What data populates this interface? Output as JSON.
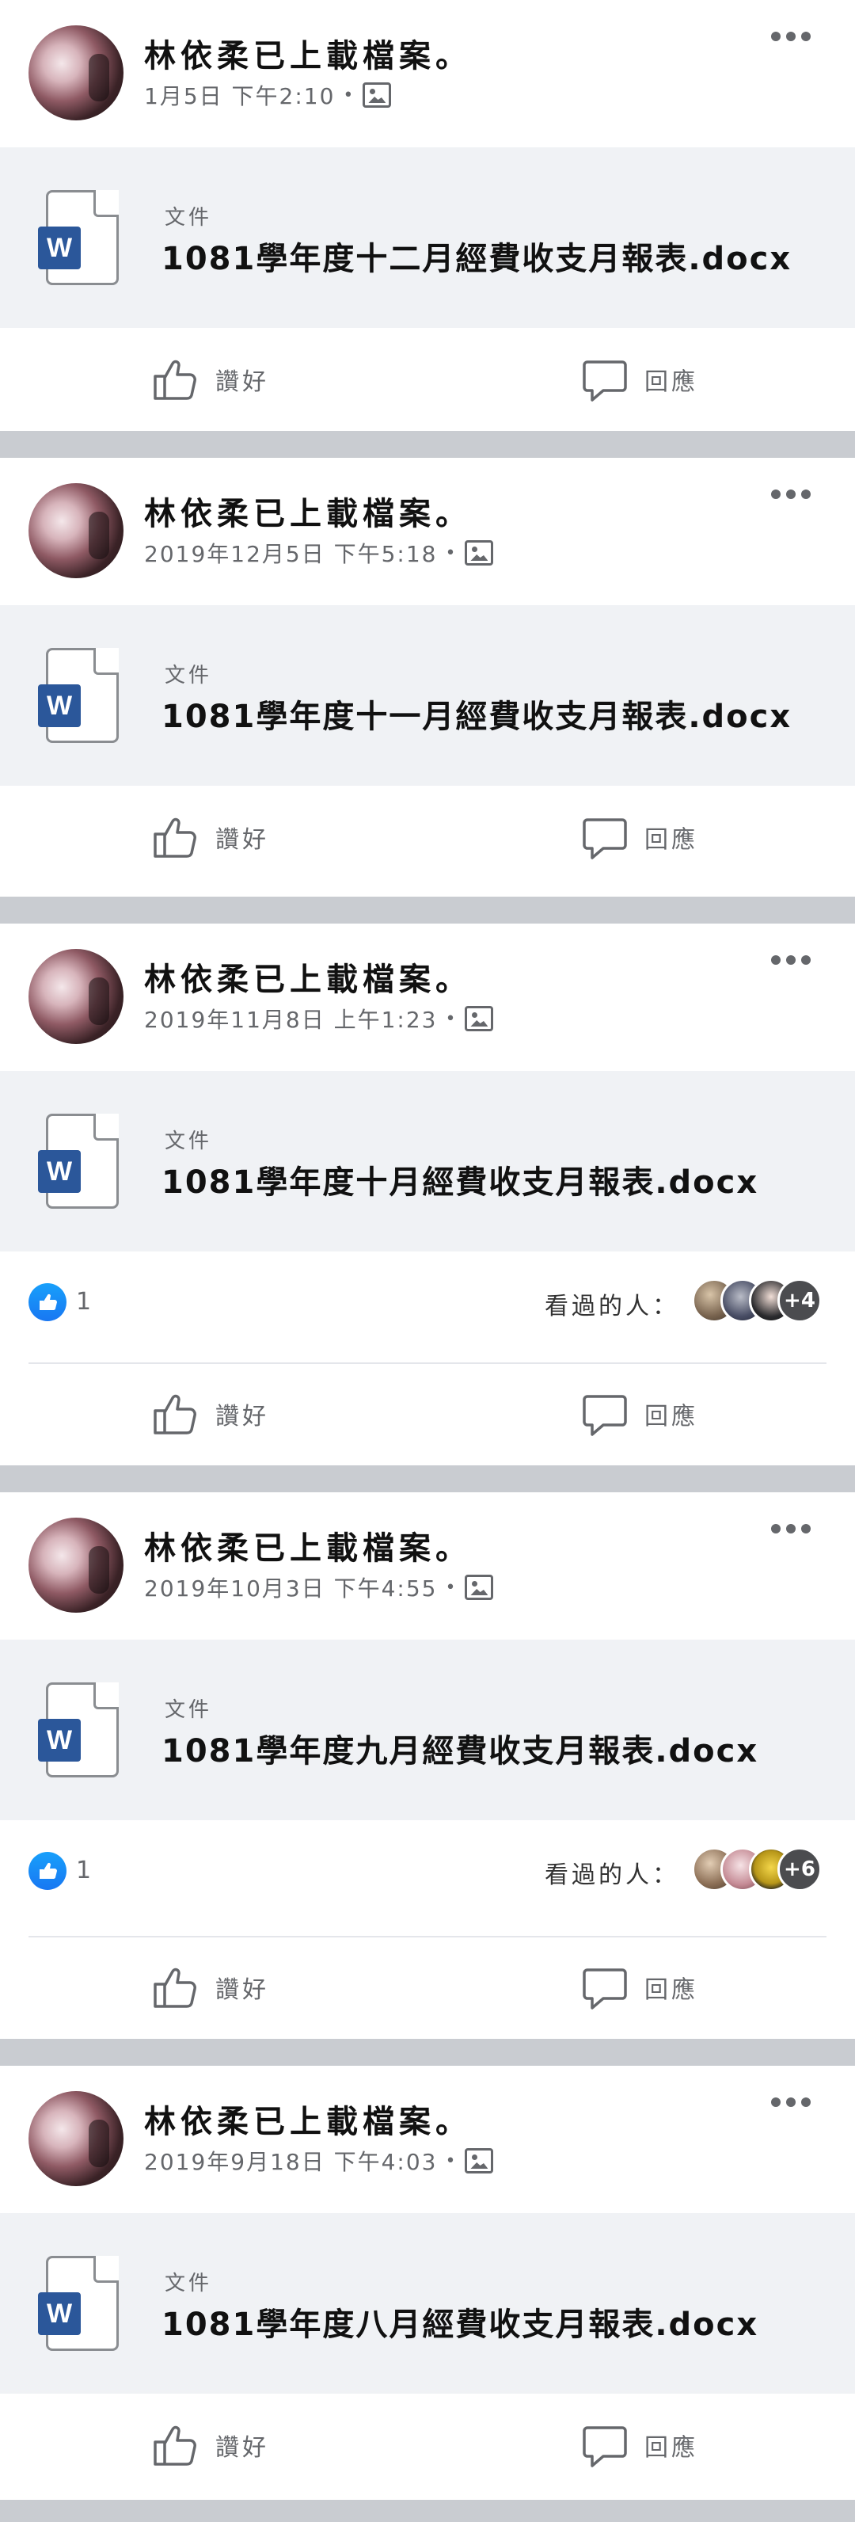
{
  "icons": {
    "more": "more-horizontal-icon",
    "album": "photo-album-icon",
    "document": "word-document-icon",
    "like": "thumbs-up-icon",
    "comment": "comment-bubble-icon",
    "reaction": "like-reaction-icon"
  },
  "colors": {
    "facebook_blue": "#1877f2",
    "word_blue": "#2b579a",
    "secondary_text": "#65676b",
    "file_bg": "#f0f2f5",
    "separator": "#c9ccd1"
  },
  "posts": [
    {
      "author": "林依柔已上載檔案。",
      "timestamp": "1月5日 下午2:10",
      "dot": "•",
      "file_type": "文件",
      "file_name": "1081學年度十二月經費收支月報表.docx",
      "like_label": "讚好",
      "comment_label": "回應"
    },
    {
      "author": "林依柔已上載檔案。",
      "timestamp": "2019年12月5日 下午5:18",
      "dot": "•",
      "file_type": "文件",
      "file_name": "1081學年度十一月經費收支月報表.docx",
      "like_label": "讚好",
      "comment_label": "回應"
    },
    {
      "author": "林依柔已上載檔案。",
      "timestamp": "2019年11月8日 上午1:23",
      "dot": "•",
      "file_type": "文件",
      "file_name": "1081學年度十月經費收支月報表.docx",
      "reactions": {
        "like_count": "1",
        "seen_label": "看過的人：",
        "seen_more": "+4"
      },
      "like_label": "讚好",
      "comment_label": "回應"
    },
    {
      "author": "林依柔已上載檔案。",
      "timestamp": "2019年10月3日 下午4:55",
      "dot": "•",
      "file_type": "文件",
      "file_name": "1081學年度九月經費收支月報表.docx",
      "reactions": {
        "like_count": "1",
        "seen_label": "看過的人：",
        "seen_more": "+6"
      },
      "like_label": "讚好",
      "comment_label": "回應"
    },
    {
      "author": "林依柔已上載檔案。",
      "timestamp": "2019年9月18日 下午4:03",
      "dot": "•",
      "file_type": "文件",
      "file_name": "1081學年度八月經費收支月報表.docx",
      "like_label": "讚好",
      "comment_label": "回應"
    }
  ]
}
